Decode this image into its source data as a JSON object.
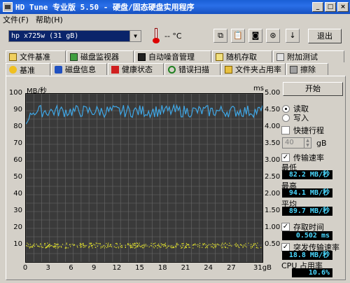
{
  "window": {
    "title": "HD Tune 专业版 5.50 - 硬盘/固态硬盘实用程序",
    "controls": [
      "_",
      "□",
      "×"
    ]
  },
  "menu": [
    "文件(F)",
    "帮助(H)"
  ],
  "toolbar": {
    "drive": "hp        x725w (31 gB)",
    "temperature": "-- °C",
    "exit_label": "退出",
    "icons": [
      "copy-icon",
      "paste-icon",
      "camera-icon",
      "disk-icon",
      "download-icon"
    ]
  },
  "tabs_top": [
    "文件基准",
    "磁盘监视器",
    "自动噪音管理",
    "随机存取",
    "附加测试"
  ],
  "tabs_bottom": [
    "基准",
    "磁盘信息",
    "健康状态",
    "错误扫描",
    "文件夹占用率",
    "擦除"
  ],
  "chart_data": {
    "type": "line",
    "ylabel_left": "MB/秒",
    "ylabel_right": "ms",
    "x_ticks": [
      "0",
      "3",
      "6",
      "9",
      "12",
      "15",
      "18",
      "21",
      "24",
      "27",
      "31gB"
    ],
    "y_ticks_left": [
      "100",
      "90",
      "80",
      "70",
      "60",
      "50",
      "40",
      "30",
      "20",
      "10",
      ""
    ],
    "y_ticks_right": [
      "5.00",
      "4.50",
      "4.00",
      "3.50",
      "3.00",
      "2.50",
      "2.00",
      "1.50",
      "1.00",
      "0.50",
      ""
    ],
    "ylim": [
      0,
      100
    ],
    "xlim": [
      0,
      31
    ],
    "grid": true,
    "series": [
      {
        "color": "#3fa7e6",
        "start": 82,
        "mean": 89.7,
        "min": 86,
        "max": 94.1
      },
      {
        "color": "#e8e82a",
        "kind": "scatter",
        "mean": 10,
        "spread": 1.5
      }
    ]
  },
  "controls": {
    "start_label": "开始",
    "read_label": "读取",
    "write_label": "写入",
    "short_stroke_label": "快捷行程",
    "short_stroke_value": "40",
    "short_stroke_unit": "gB",
    "transfer_rate_label": "传输速率",
    "min_label": "最低",
    "min_value": "82.2 MB/秒",
    "max_label": "最高",
    "max_value": "94.1 MB/秒",
    "avg_label": "平均",
    "avg_value": "89.7 MB/秒",
    "access_time_label": "存取时间",
    "access_time_value": "0.502 ms",
    "burst_label": "突发传输速率",
    "burst_value": "18.8 MB/秒",
    "cpu_label": "CPU 占用率",
    "cpu_value": "10.6%"
  },
  "colors": {
    "titlebar": "#2a6fe8",
    "graph_bg": "#3a3a3a",
    "grid": "#6a6a6a",
    "value_text": "#4ad8ff"
  }
}
